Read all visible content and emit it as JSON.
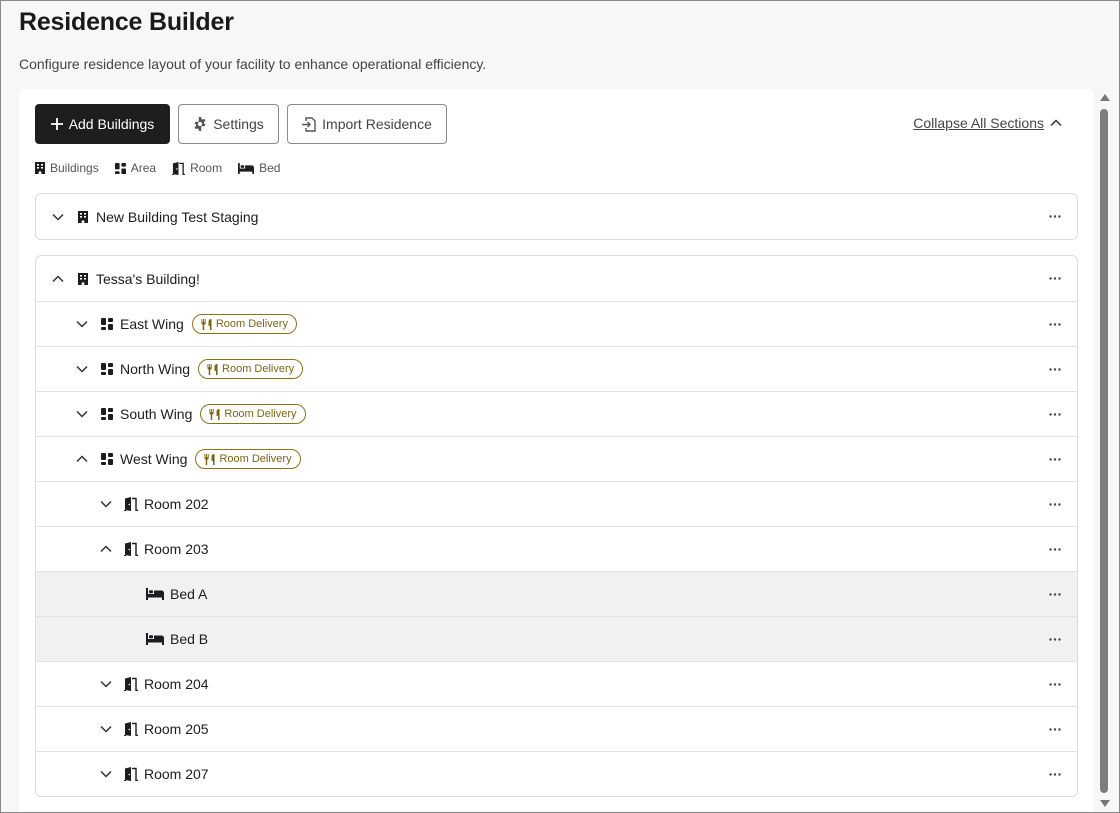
{
  "page": {
    "title": "Residence Builder",
    "subtitle": "Configure residence layout of your facility to enhance operational efficiency."
  },
  "toolbar": {
    "add_label": "Add Buildings",
    "settings_label": "Settings",
    "import_label": "Import Residence",
    "collapse_label": "Collapse All Sections"
  },
  "legend": {
    "buildings": "Buildings",
    "area": "Area",
    "room": "Room",
    "bed": "Bed"
  },
  "badge_label": "Room Delivery",
  "buildings": [
    {
      "name": "New Building Test Staging",
      "expanded": false
    },
    {
      "name": "Tessa's Building!",
      "expanded": true,
      "areas": [
        {
          "name": "East Wing",
          "expanded": false,
          "badge": "Room Delivery"
        },
        {
          "name": "North Wing",
          "expanded": false,
          "badge": "Room Delivery"
        },
        {
          "name": "South Wing",
          "expanded": false,
          "badge": "Room Delivery"
        },
        {
          "name": "West Wing",
          "expanded": true,
          "badge": "Room Delivery",
          "rooms": [
            {
              "name": "Room 202",
              "expanded": false
            },
            {
              "name": "Room 203",
              "expanded": true,
              "beds": [
                {
                  "name": "Bed A"
                },
                {
                  "name": "Bed B"
                }
              ]
            },
            {
              "name": "Room 204",
              "expanded": false
            },
            {
              "name": "Room 205",
              "expanded": false
            },
            {
              "name": "Room 207",
              "expanded": false
            }
          ]
        }
      ]
    }
  ],
  "colors": {
    "primary_button": "#1e1e1e",
    "badge": "#7d6510",
    "bed_row_bg": "#f1f1f1"
  }
}
